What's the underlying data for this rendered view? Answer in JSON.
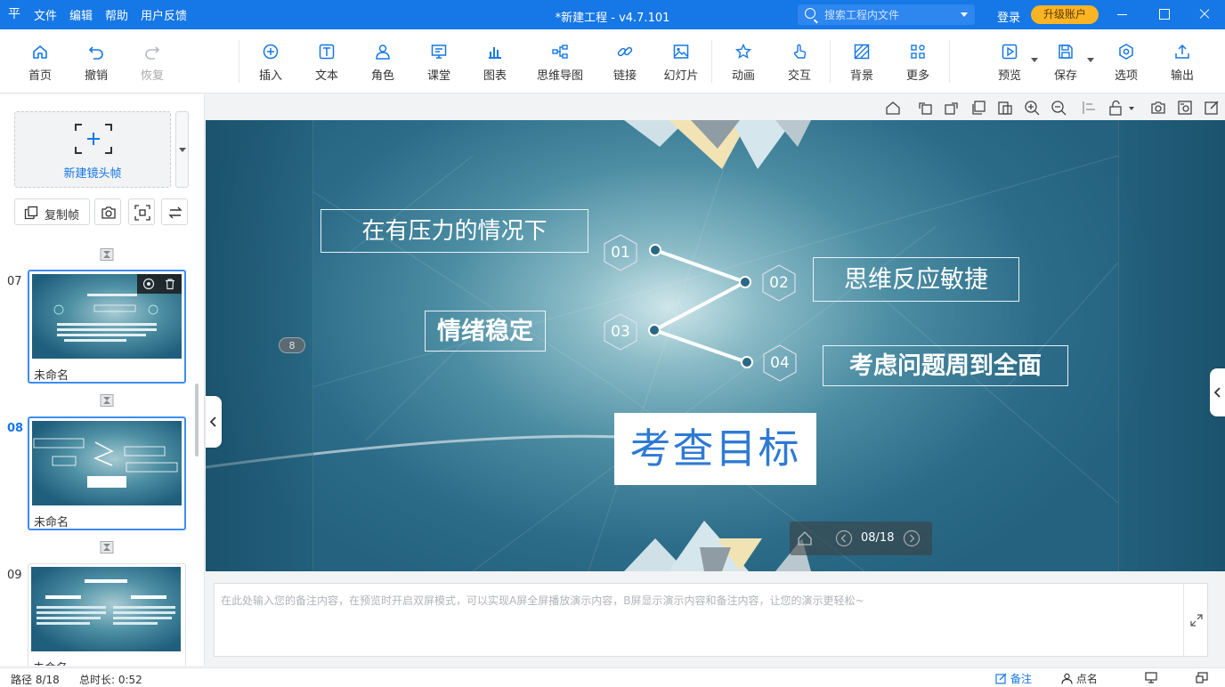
{
  "app": {
    "title": "*新建工程 - v4.7.101",
    "logo": "平",
    "menu": [
      "文件",
      "编辑",
      "帮助",
      "用户反馈"
    ],
    "search_placeholder": "搜索工程内文件",
    "login": "登录",
    "upgrade": "升级账户",
    "accent": "#1677e6"
  },
  "toolbar": {
    "home": "首页",
    "undo": "撤销",
    "redo": "恢复",
    "insert": "插入",
    "text": "文本",
    "role": "角色",
    "classroom": "课堂",
    "chart": "图表",
    "mindmap": "思维导图",
    "link": "链接",
    "slideshow": "幻灯片",
    "animation": "动画",
    "interaction": "交互",
    "background": "背景",
    "more": "更多",
    "preview": "预览",
    "save": "保存",
    "options": "选项",
    "export": "输出"
  },
  "sidebar": {
    "new_frame": "新建镜头帧",
    "copy_frame": "复制帧",
    "slides": [
      {
        "number": "07",
        "name": "未命名",
        "selected": false
      },
      {
        "number": "08",
        "name": "未命名",
        "selected": true
      },
      {
        "number": "09",
        "name": "未命名",
        "selected": false
      }
    ]
  },
  "slide": {
    "text_left_top": "在有压力的情况下",
    "text_left_mid": "情绪稳定",
    "text_right_top": "思维反应敏捷",
    "text_right_bottom": "考虑问题周到全面",
    "title": "考查目标",
    "hex_labels": [
      "01",
      "02",
      "03",
      "04"
    ],
    "side_badge": "8"
  },
  "navigator": {
    "page": "08/18"
  },
  "notes": {
    "placeholder": "在此处输入您的备注内容，在预览时开启双屏模式，可以实现A屏全屏播放演示内容，B屏显示演示内容和备注内容，让您的演示更轻松~"
  },
  "status": {
    "path": "路径 8/18",
    "duration": "总时长: 0:52",
    "notes": "备注",
    "roll_call": "点名"
  }
}
